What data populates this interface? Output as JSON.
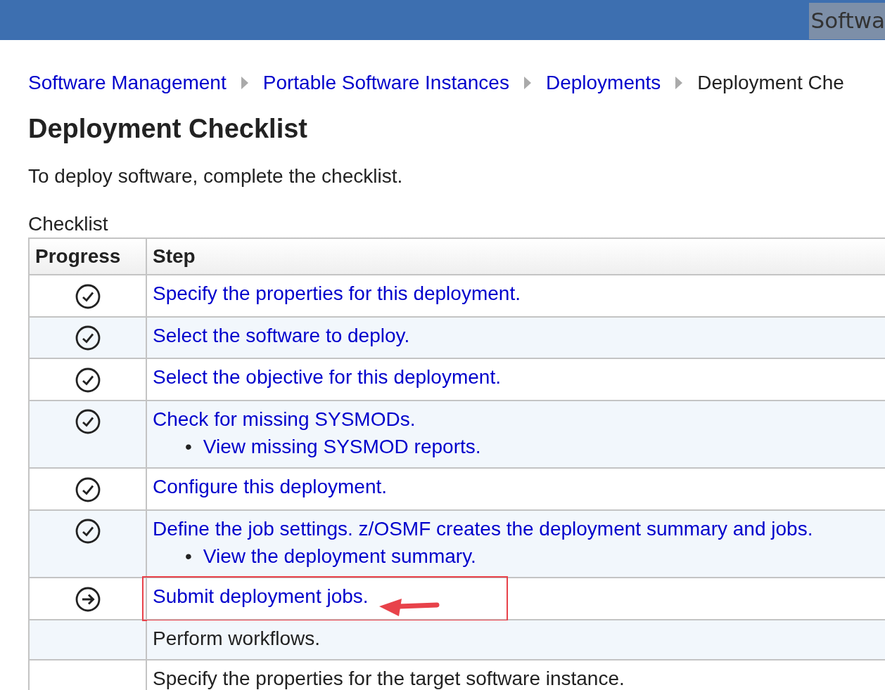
{
  "top_bar": {
    "title": "Softwa"
  },
  "breadcrumb": [
    {
      "label": "Software Management",
      "link": true
    },
    {
      "label": "Portable Software Instances",
      "link": true
    },
    {
      "label": "Deployments",
      "link": true
    },
    {
      "label": "Deployment Che",
      "link": false
    }
  ],
  "heading": "Deployment Checklist",
  "intro": "To deploy software, complete the checklist.",
  "checklist": {
    "caption": "Checklist",
    "columns": [
      "Progress",
      "Step"
    ],
    "rows": [
      {
        "kind": "done",
        "step": "Specify the properties for this deployment.",
        "link": true,
        "highlighted": false
      },
      {
        "kind": "done",
        "step": "Select the software to deploy.",
        "link": true,
        "highlighted": false
      },
      {
        "kind": "done",
        "step": "Select the objective for this deployment.",
        "link": true,
        "highlighted": false
      },
      {
        "kind": "done",
        "step": "Check for missing SYSMODs.",
        "link": true,
        "highlighted": false,
        "children": [
          {
            "marker": "•",
            "step": "View missing SYSMOD reports.",
            "link": true
          }
        ]
      },
      {
        "kind": "done",
        "step": "Configure this deployment.",
        "link": true,
        "highlighted": false
      },
      {
        "kind": "done",
        "step": "Define the job settings. z/OSMF creates the deployment summary and jobs.",
        "link": true,
        "highlighted": false,
        "children": [
          {
            "marker": "•",
            "step": "View the deployment summary.",
            "link": true
          }
        ]
      },
      {
        "kind": "current",
        "step": "Submit deployment jobs.",
        "link": true,
        "highlighted": true
      },
      {
        "kind": "pending",
        "step": "Perform workflows.",
        "link": false,
        "highlighted": false
      },
      {
        "kind": "pending",
        "step": "Specify the properties for the target software instance.",
        "link": false,
        "highlighted": false
      }
    ]
  }
}
